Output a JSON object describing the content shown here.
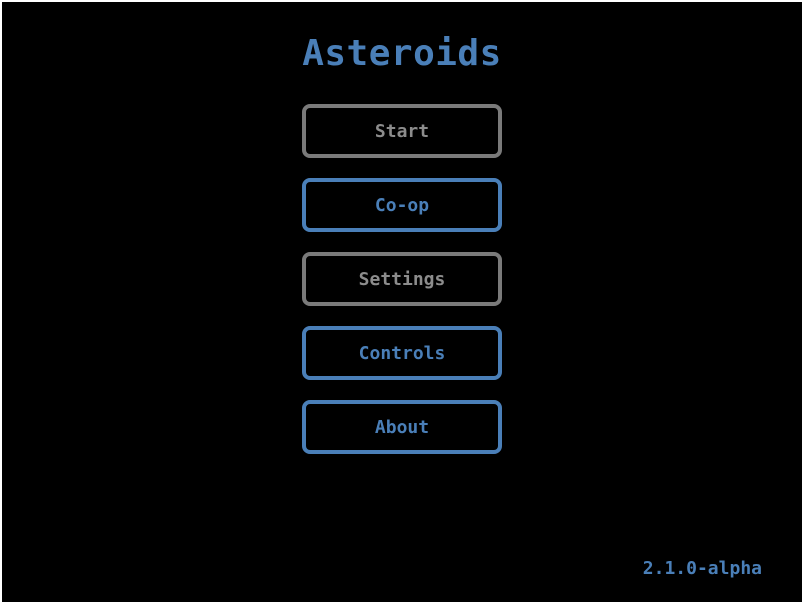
{
  "game": {
    "title": "Asteroids",
    "version": "2.1.0-alpha"
  },
  "menu": {
    "buttons": [
      {
        "label": "Start",
        "style": "gray"
      },
      {
        "label": "Co-op",
        "style": "blue"
      },
      {
        "label": "Settings",
        "style": "gray"
      },
      {
        "label": "Controls",
        "style": "blue"
      },
      {
        "label": "About",
        "style": "blue"
      }
    ]
  },
  "colors": {
    "background": "#000000",
    "accent_blue": "#4a7fb8",
    "border_gray": "#7a7a7a",
    "text_gray": "#8c8c8c"
  }
}
